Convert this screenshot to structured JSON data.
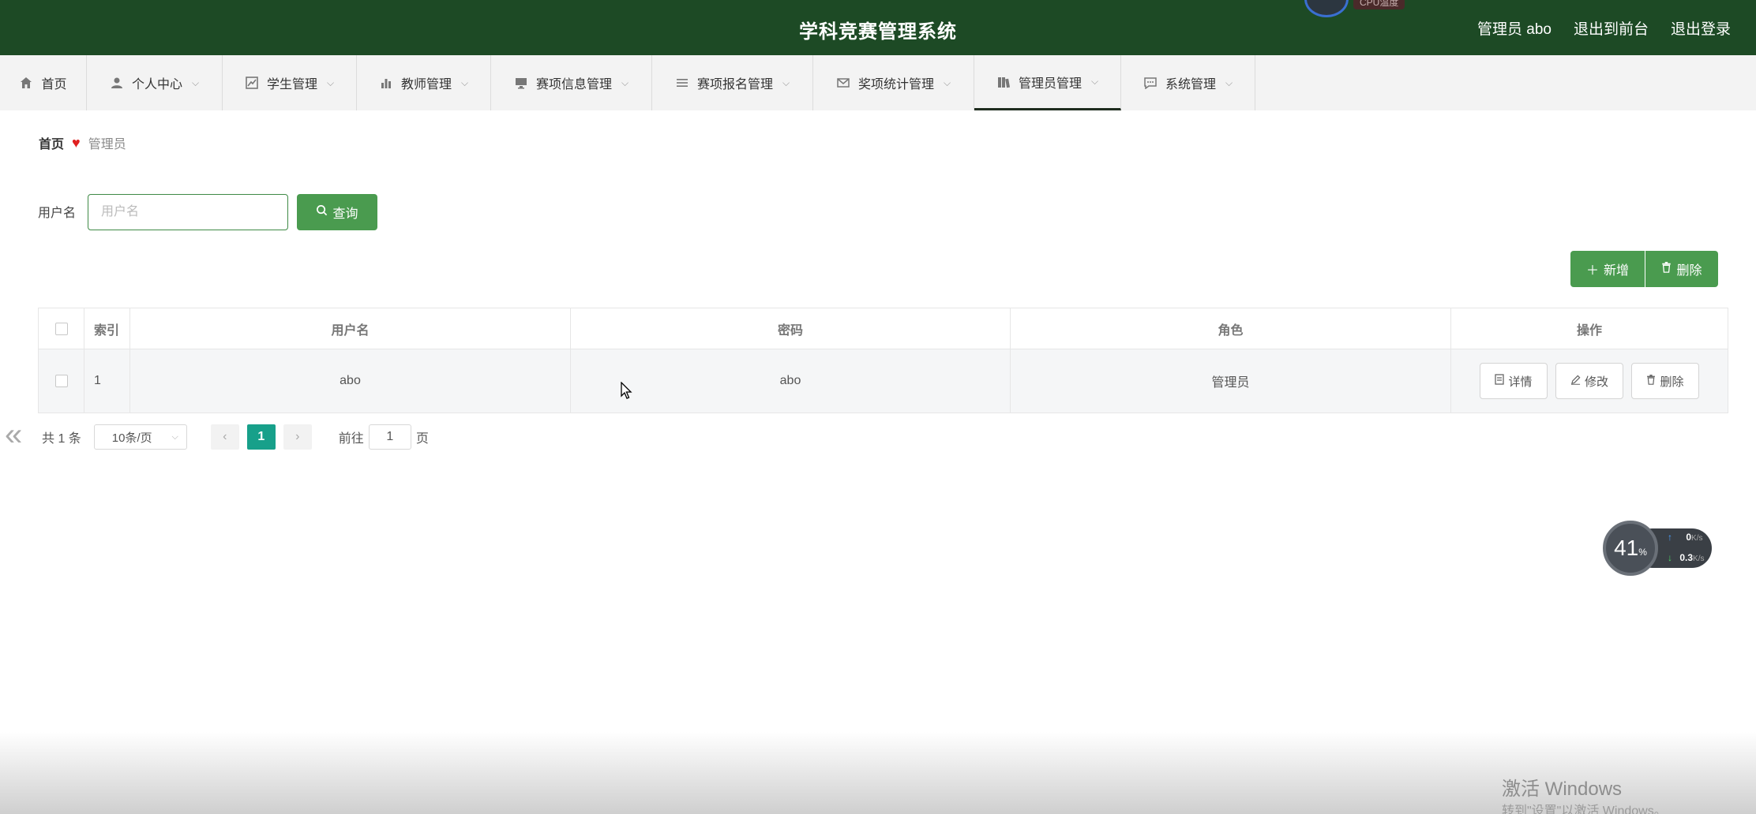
{
  "header": {
    "title": "学科竞赛管理系统",
    "user": "管理员 abo",
    "to_front": "退出到前台",
    "logout": "退出登录",
    "cpu_label": "CPU温度"
  },
  "nav": [
    {
      "label": "首页",
      "icon": "home-icon"
    },
    {
      "label": "个人中心",
      "icon": "person-icon"
    },
    {
      "label": "学生管理",
      "icon": "chart-icon"
    },
    {
      "label": "教师管理",
      "icon": "bar-chart-icon"
    },
    {
      "label": "赛项信息管理",
      "icon": "monitor-icon"
    },
    {
      "label": "赛项报名管理",
      "icon": "list-icon"
    },
    {
      "label": "奖项统计管理",
      "icon": "mail-icon"
    },
    {
      "label": "管理员管理",
      "icon": "book-icon",
      "active": true
    },
    {
      "label": "系统管理",
      "icon": "chat-icon"
    }
  ],
  "breadcrumb": {
    "home": "首页",
    "current": "管理员"
  },
  "search": {
    "label": "用户名",
    "placeholder": "用户名",
    "button": "查询"
  },
  "actions": {
    "add": "新增",
    "delete": "删除"
  },
  "table": {
    "columns": [
      "索引",
      "用户名",
      "密码",
      "角色",
      "操作"
    ],
    "rows": [
      {
        "index": "1",
        "username": "abo",
        "password": "abo",
        "role": "管理员"
      }
    ],
    "ops": {
      "detail": "详情",
      "edit": "修改",
      "delete": "删除"
    }
  },
  "pagination": {
    "total": "共 1 条",
    "page_size": "10条/页",
    "current": "1",
    "goto_label": "前往",
    "goto_value": "1",
    "page_suffix": "页"
  },
  "net_widget": {
    "percent": "41",
    "percent_unit": "%",
    "up": "0",
    "down": "0.3",
    "unit": "K/s"
  },
  "watermark": {
    "line1": "激活 Windows",
    "line2": "转到\"设置\"以激活 Windows。"
  },
  "colors": {
    "header_bg": "#1d4a25",
    "primary_green": "#4a9b4f",
    "page_active": "#17a08a"
  }
}
